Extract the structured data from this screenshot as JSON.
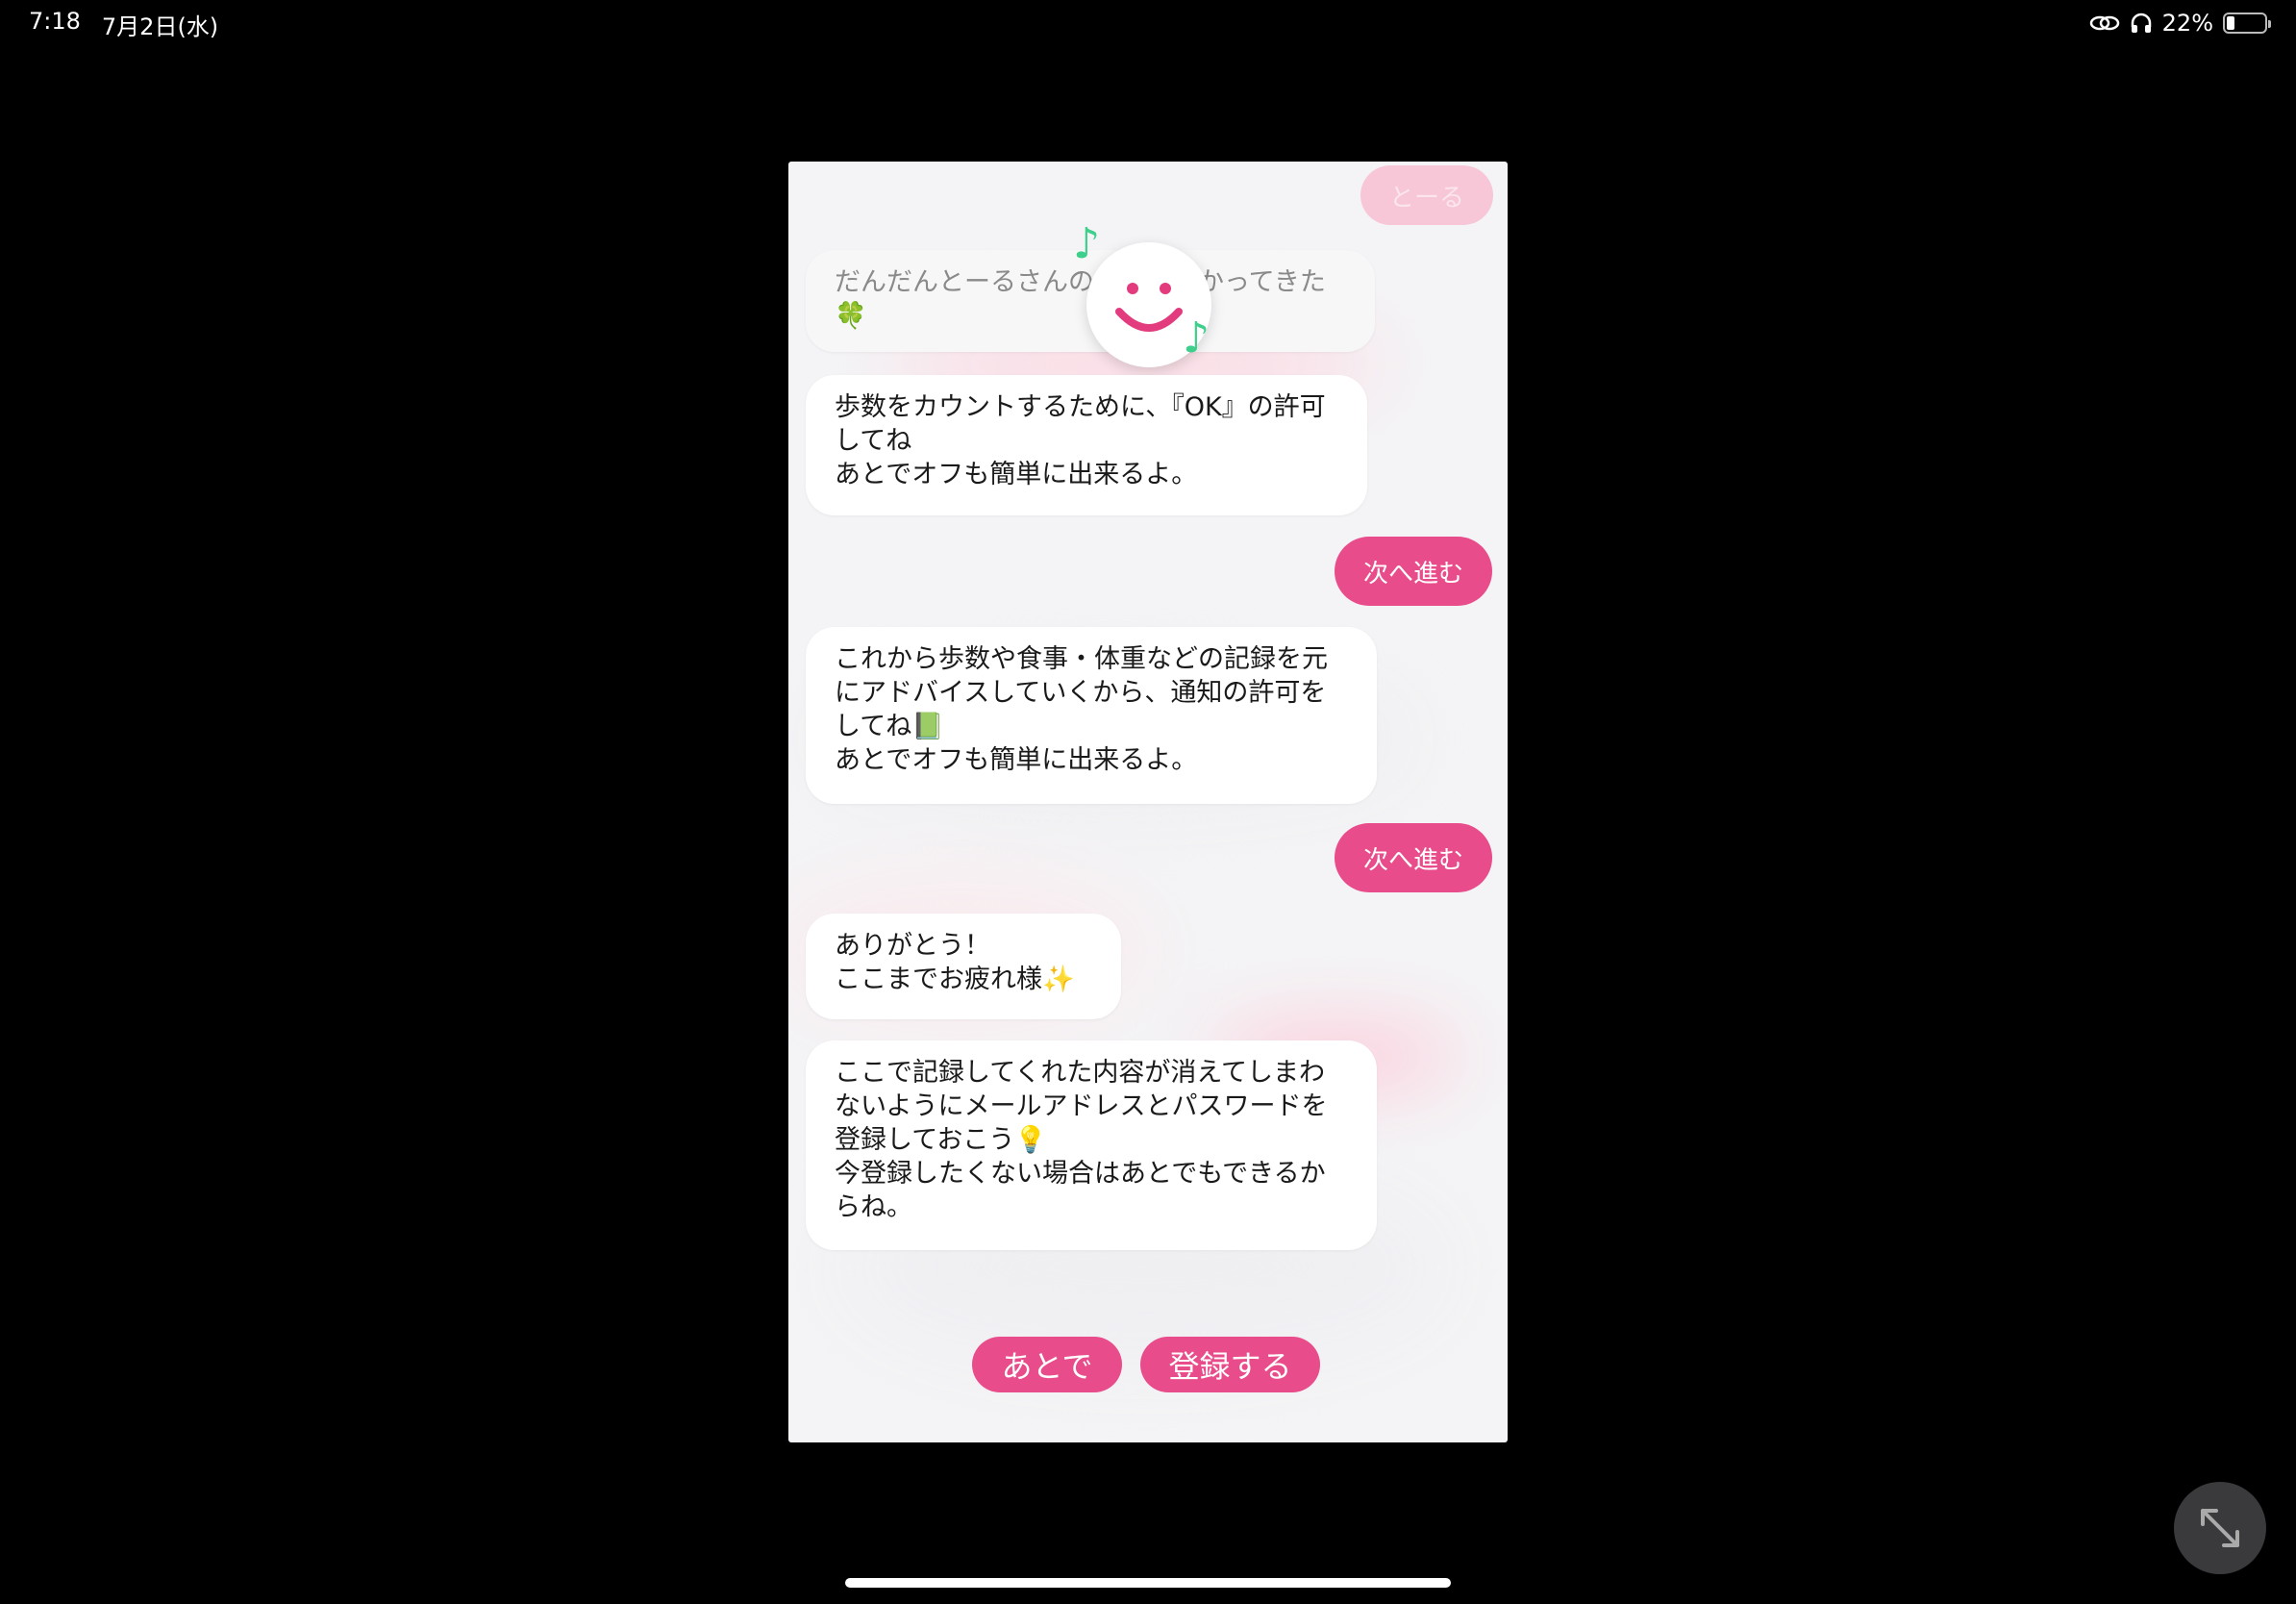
{
  "status_bar": {
    "time": "7:18",
    "date": "7月2日(水)",
    "battery": "22%",
    "battery_level": 0.22
  },
  "chat": {
    "faded_reply": "とーる",
    "faded_message": "だんだんとーるさんのことがわかってきた🍀",
    "messages": [
      {
        "text": "歩数をカウントするために、『OK』の許可してね\nあとでオフも簡単に出来るよ。"
      },
      {
        "reply": "次へ進む"
      },
      {
        "text": "これから歩数や食事・体重などの記録を元にアドバイスしていくから、通知の許可をしてね📗\nあとでオフも簡単に出来るよ。"
      },
      {
        "reply": "次へ進む"
      },
      {
        "text": "ありがとう！\nここまでお疲れ様✨"
      },
      {
        "text": "ここで記録してくれた内容が消えてしまわないようにメールアドレスとパスワードを登録しておこう💡\n今登録したくない場合はあとでもできるからね。"
      }
    ]
  },
  "actions": {
    "later": "あとで",
    "register": "登録する"
  },
  "colors": {
    "accent": "#e84c8a",
    "note": "#3fcf8c",
    "background": "#000000"
  },
  "icons": {
    "link": "link-icon",
    "headphones": "headphones-icon",
    "expand": "expand-icon",
    "mascot": "smiley-icon",
    "note": "music-note-icon"
  }
}
